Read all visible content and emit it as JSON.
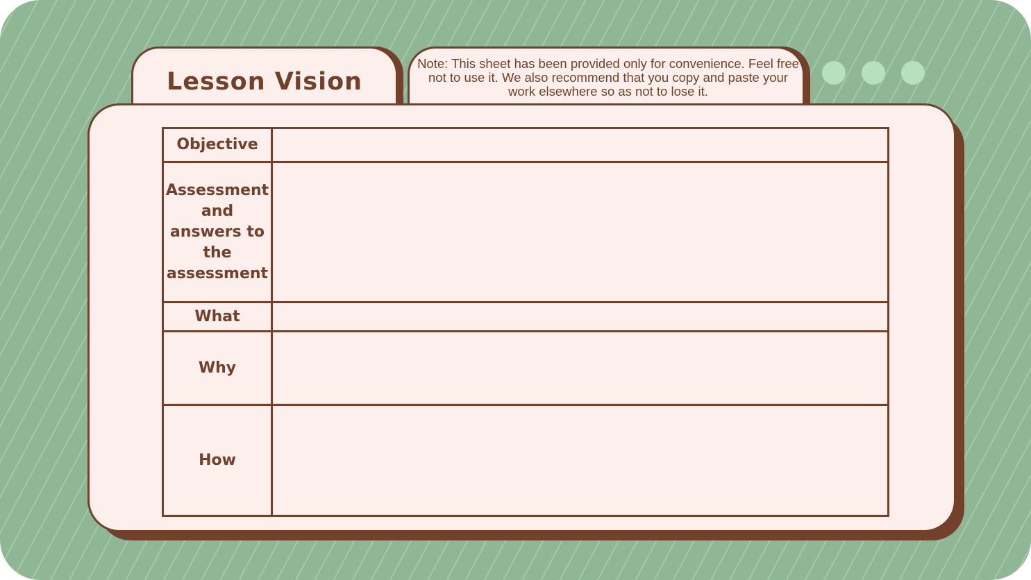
{
  "title_tab": {
    "text": "Lesson Vision"
  },
  "note_tab": {
    "text": "Note: This sheet has been provided only for convenience. Feel free not to use it. We also recommend that you copy and paste your work elsewhere so as not to lose it."
  },
  "decor_dots": {
    "count": 3,
    "color": "#b6e0c0"
  },
  "table": {
    "rows": [
      {
        "label": "Objective",
        "value": ""
      },
      {
        "label": "Assessment and answers to the assessment",
        "value": ""
      },
      {
        "label": "What",
        "value": ""
      },
      {
        "label": "Why",
        "value": ""
      },
      {
        "label": "How",
        "value": ""
      }
    ]
  },
  "colors": {
    "background": "#8fb796",
    "stripe": "#a6c7ac",
    "card": "#fdf0ec",
    "ink": "#73402c"
  }
}
